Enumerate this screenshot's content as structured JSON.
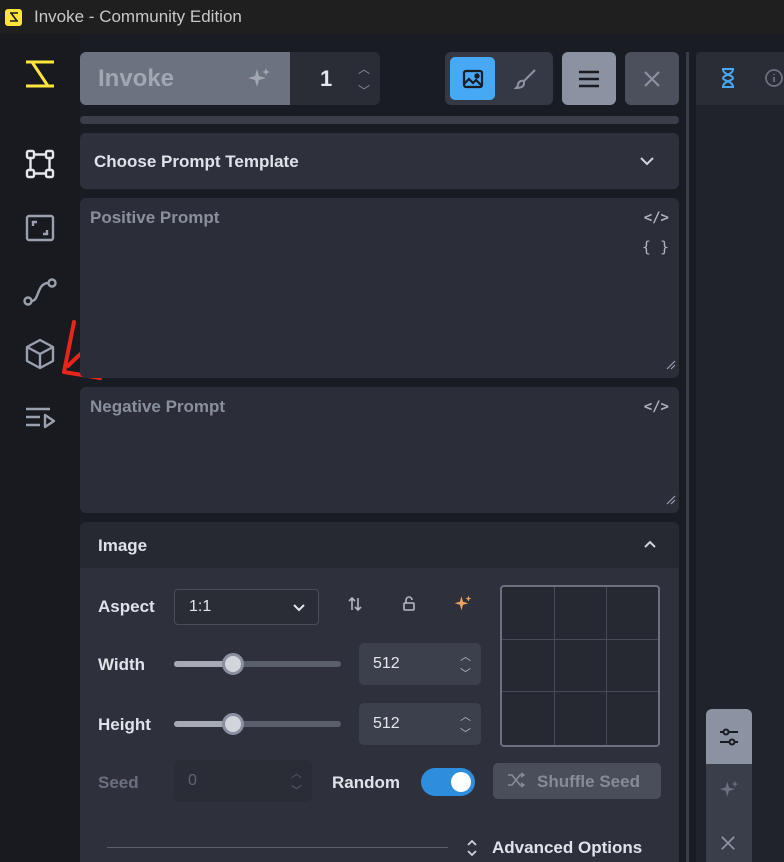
{
  "window": {
    "title": "Invoke - Community Edition"
  },
  "topbar": {
    "invoke_label": "Invoke",
    "iterations": "1"
  },
  "prompt_template": {
    "label": "Choose Prompt Template"
  },
  "positive_prompt": {
    "placeholder": "Positive Prompt"
  },
  "negative_prompt": {
    "placeholder": "Negative Prompt"
  },
  "image": {
    "section_title": "Image",
    "aspect_label": "Aspect",
    "aspect_value": "1:1",
    "width_label": "Width",
    "width_value": "512",
    "height_label": "Height",
    "height_value": "512",
    "seed_label": "Seed",
    "seed_value": "0",
    "random_label": "Random",
    "random_enabled": true,
    "shuffle_label": "Shuffle Seed",
    "advanced_label": "Advanced Options"
  },
  "sliders": {
    "width_fraction": 0.33,
    "height_fraction": 0.33
  },
  "colors": {
    "accent": "#2f8dde",
    "brand": "#fde53b",
    "annotation": "#e8251a"
  },
  "icons": {
    "rail": [
      "workflow-icon",
      "canvas-icon",
      "nodes-icon",
      "models-icon",
      "queue-icon"
    ],
    "right": [
      "hourglass-icon",
      "info-icon"
    ]
  }
}
